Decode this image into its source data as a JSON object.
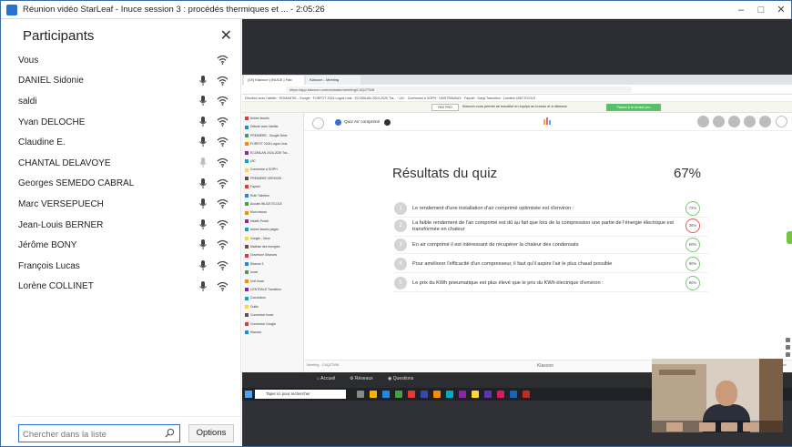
{
  "window": {
    "title": "Réunion vidéo StarLeaf - Inuce session 3 : procédés thermiques et ... - 2:05:26",
    "controls": [
      "minimize-icon",
      "maximize-icon",
      "close-icon"
    ]
  },
  "participants": {
    "title": "Participants",
    "list": [
      {
        "name": "Vous",
        "mic": false
      },
      {
        "name": "DANIEL Sidonie",
        "mic": true
      },
      {
        "name": "saldi",
        "mic": true
      },
      {
        "name": "Yvan DELOCHE",
        "mic": true
      },
      {
        "name": "Claudine E.",
        "mic": true
      },
      {
        "name": "CHANTAL DELAVOYE",
        "mic": true
      },
      {
        "name": "Georges SEMEDO CABRAL",
        "mic": true
      },
      {
        "name": "Marc VERSEPUECH",
        "mic": true
      },
      {
        "name": "Jean-Louis BERNER",
        "mic": true
      },
      {
        "name": "Jérôme BONY",
        "mic": true
      },
      {
        "name": "François Lucas",
        "mic": true
      },
      {
        "name": "Lorène COLLINET",
        "mic": true
      }
    ],
    "search_placeholder": "Chercher dans la liste",
    "options_label": "Options"
  },
  "shared": {
    "tabs": [
      "(19) Klaxoon | INUCE | Fab",
      "Klaxoon - Meeting"
    ],
    "address": "https://app.klaxoon.com/animate/meeting/C4QZTW8",
    "bookmarks": "Décollez avec l'atelier  ·  ROMANTIK - Google  ·  FORFOT 2024 Logos Unis  ·  ECOBILAN 2024-2025 Tra...  ·  UIC  ·  Connexion à SOPH  ·  DMSTRAVAUX  ·  Fayciel  ·  Dargi Transition  ·  Lumière UNIT ECOLE",
    "promo": {
      "left_button": "PAS PRO",
      "message": "Klaxoon vous permet de travailler en équipe au bureau et à distance",
      "right_button": "Passer à la version pro"
    },
    "sidebar_items": [
      "Autres favoris",
      "Débuté avec l'atelier",
      "PREMIÈRE - Google Drive",
      "FORFOT 2024 Logos Unis",
      "ECOBILAN 2024-2025 Tra...",
      "UIC",
      "Connexion à SOPH",
      "PREMIÈRE VERSION",
      "Fayciel",
      "Ruth Toiletton",
      "Accueil INUCE ECOLE",
      "Mon réseau",
      "Health Portal",
      "Autres favoris pages",
      "Google - Drive",
      "Maîtrise des énergies",
      "Ouverture Séances",
      "Séance 3",
      "Inuce",
      "Unit Inuce",
      "CENTRALE Transition",
      "Conclusion",
      "Outils",
      "Connexion Inuce",
      "Connexion Google",
      "Klaxoon"
    ],
    "quiz_pill": "Quiz Air comprimé",
    "results_title": "Résultats du quiz",
    "results_pct": "67%",
    "questions": [
      {
        "num": "1",
        "text": "Le rendement d'une installation d'air comprimé optimisée est d'environ :",
        "score": "72%",
        "color": "#7ec879"
      },
      {
        "num": "2",
        "text": "La faible rendement de l'air comprimé est dû au fait que lors de la compression une partie de l'énergie électrique est transformée en chaleur",
        "score": "36%",
        "color": "#e06060"
      },
      {
        "num": "3",
        "text": "En air comprimé il est intéressant de récupérer la chaleur des condensats",
        "score": "60%",
        "color": "#7ec879"
      },
      {
        "num": "4",
        "text": "Pour améliorer l'efficacité d'un compresseur, il faut qu'il aspire l'air le plus chaud possible",
        "score": "90%",
        "color": "#7ec879"
      },
      {
        "num": "5",
        "text": "Le prix du KWh pneumatique est plus élevé que le prix du KWh électrique d'environ :",
        "score": "80%",
        "color": "#7ec879"
      }
    ],
    "footer_left": "Meeting · C4QZTW8",
    "footer_center": "Klaxoon",
    "footer_right": "Plein écran",
    "actions": [
      "Accueil",
      "Réseaux",
      "Questions"
    ],
    "taskbar_search": "Taper ici pour rechercher"
  }
}
